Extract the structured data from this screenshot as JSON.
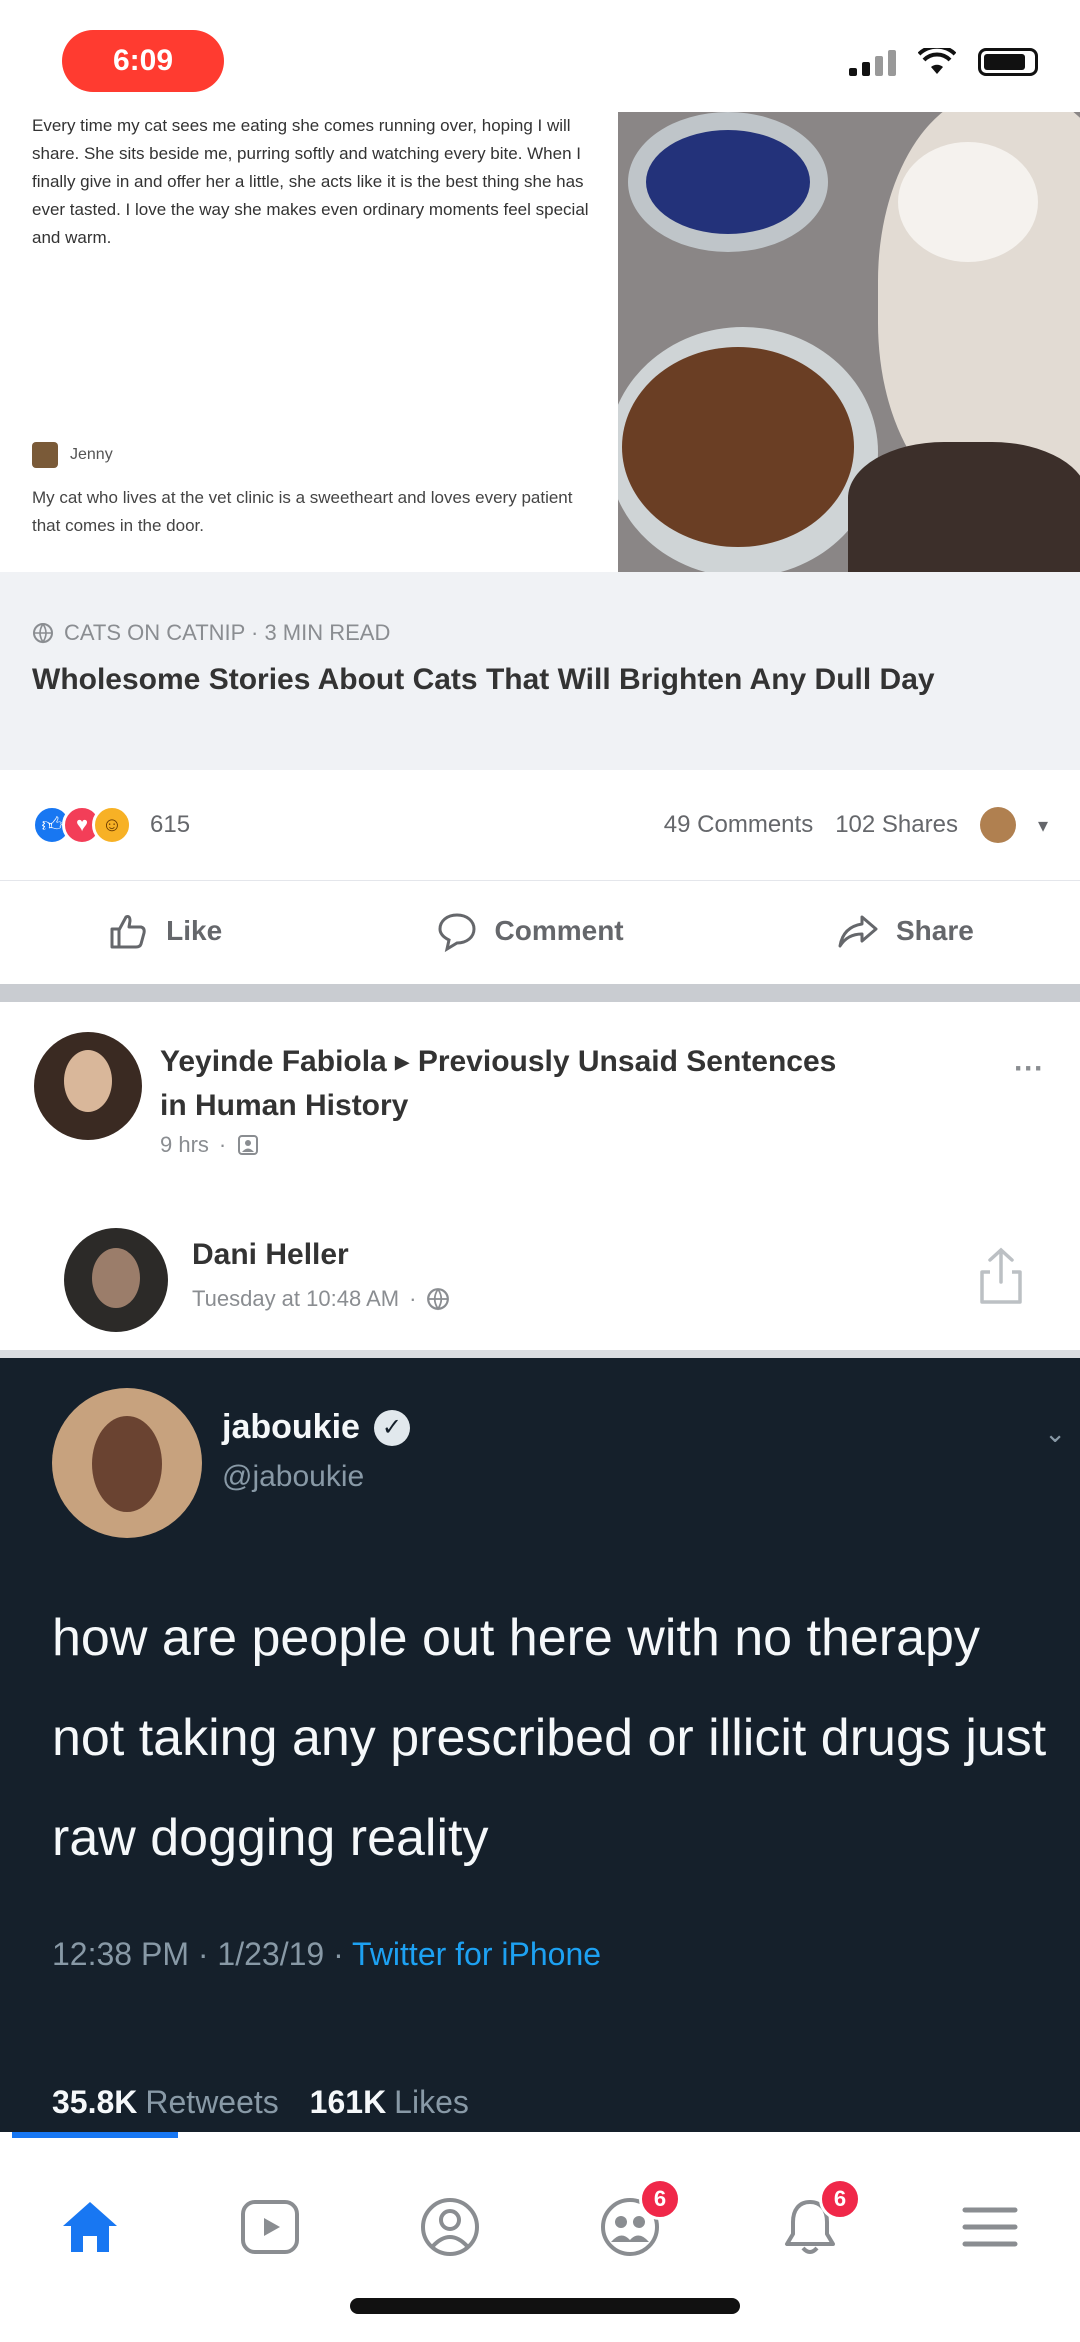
{
  "status_bar": {
    "time": "6:09"
  },
  "link_preview": {
    "article_text": "Every time my cat sees me eating she comes running over, hoping I will share. She sits beside me, purring softly and watching every bite. When I finally give in and offer her a little, she acts like it is the best thing she has ever tasted. I love the way she makes even ordinary moments feel special and warm.",
    "author": "Jenny",
    "article_text_2": "My cat who lives at the vet clinic is a sweetheart and loves every patient that comes in the door."
  },
  "link_caption": {
    "domain": "CATS ON CATNIP · 3 MIN READ",
    "title": "Wholesome Stories About Cats That Will Brighten Any Dull Day"
  },
  "reactions": {
    "count": "615",
    "comments": "49 Comments",
    "shares": "102 Shares"
  },
  "actions": {
    "like": "Like",
    "comment": "Comment",
    "share": "Share"
  },
  "post": {
    "author": "Yeyinde Fabiola",
    "arrow": "▸",
    "group": "Previously Unsaid Sentences in Human History",
    "time": "9 hrs",
    "more": "···"
  },
  "shared_post": {
    "author": "Dani Heller",
    "time": "Tuesday at 10:48 AM"
  },
  "tweet": {
    "name": "jaboukie",
    "handle": "@jaboukie",
    "text": "how are people out here with no therapy not taking any prescribed or illicit drugs just raw dogging reality",
    "timestamp": "12:38 PM · 1/23/19 ·",
    "source": "Twitter for iPhone",
    "retweets": "35.8K",
    "retweets_label": "Retweets",
    "likes": "161K",
    "likes_label": "Likes"
  },
  "bottom_nav": {
    "groups_badge": "6",
    "notifications_badge": "6"
  }
}
